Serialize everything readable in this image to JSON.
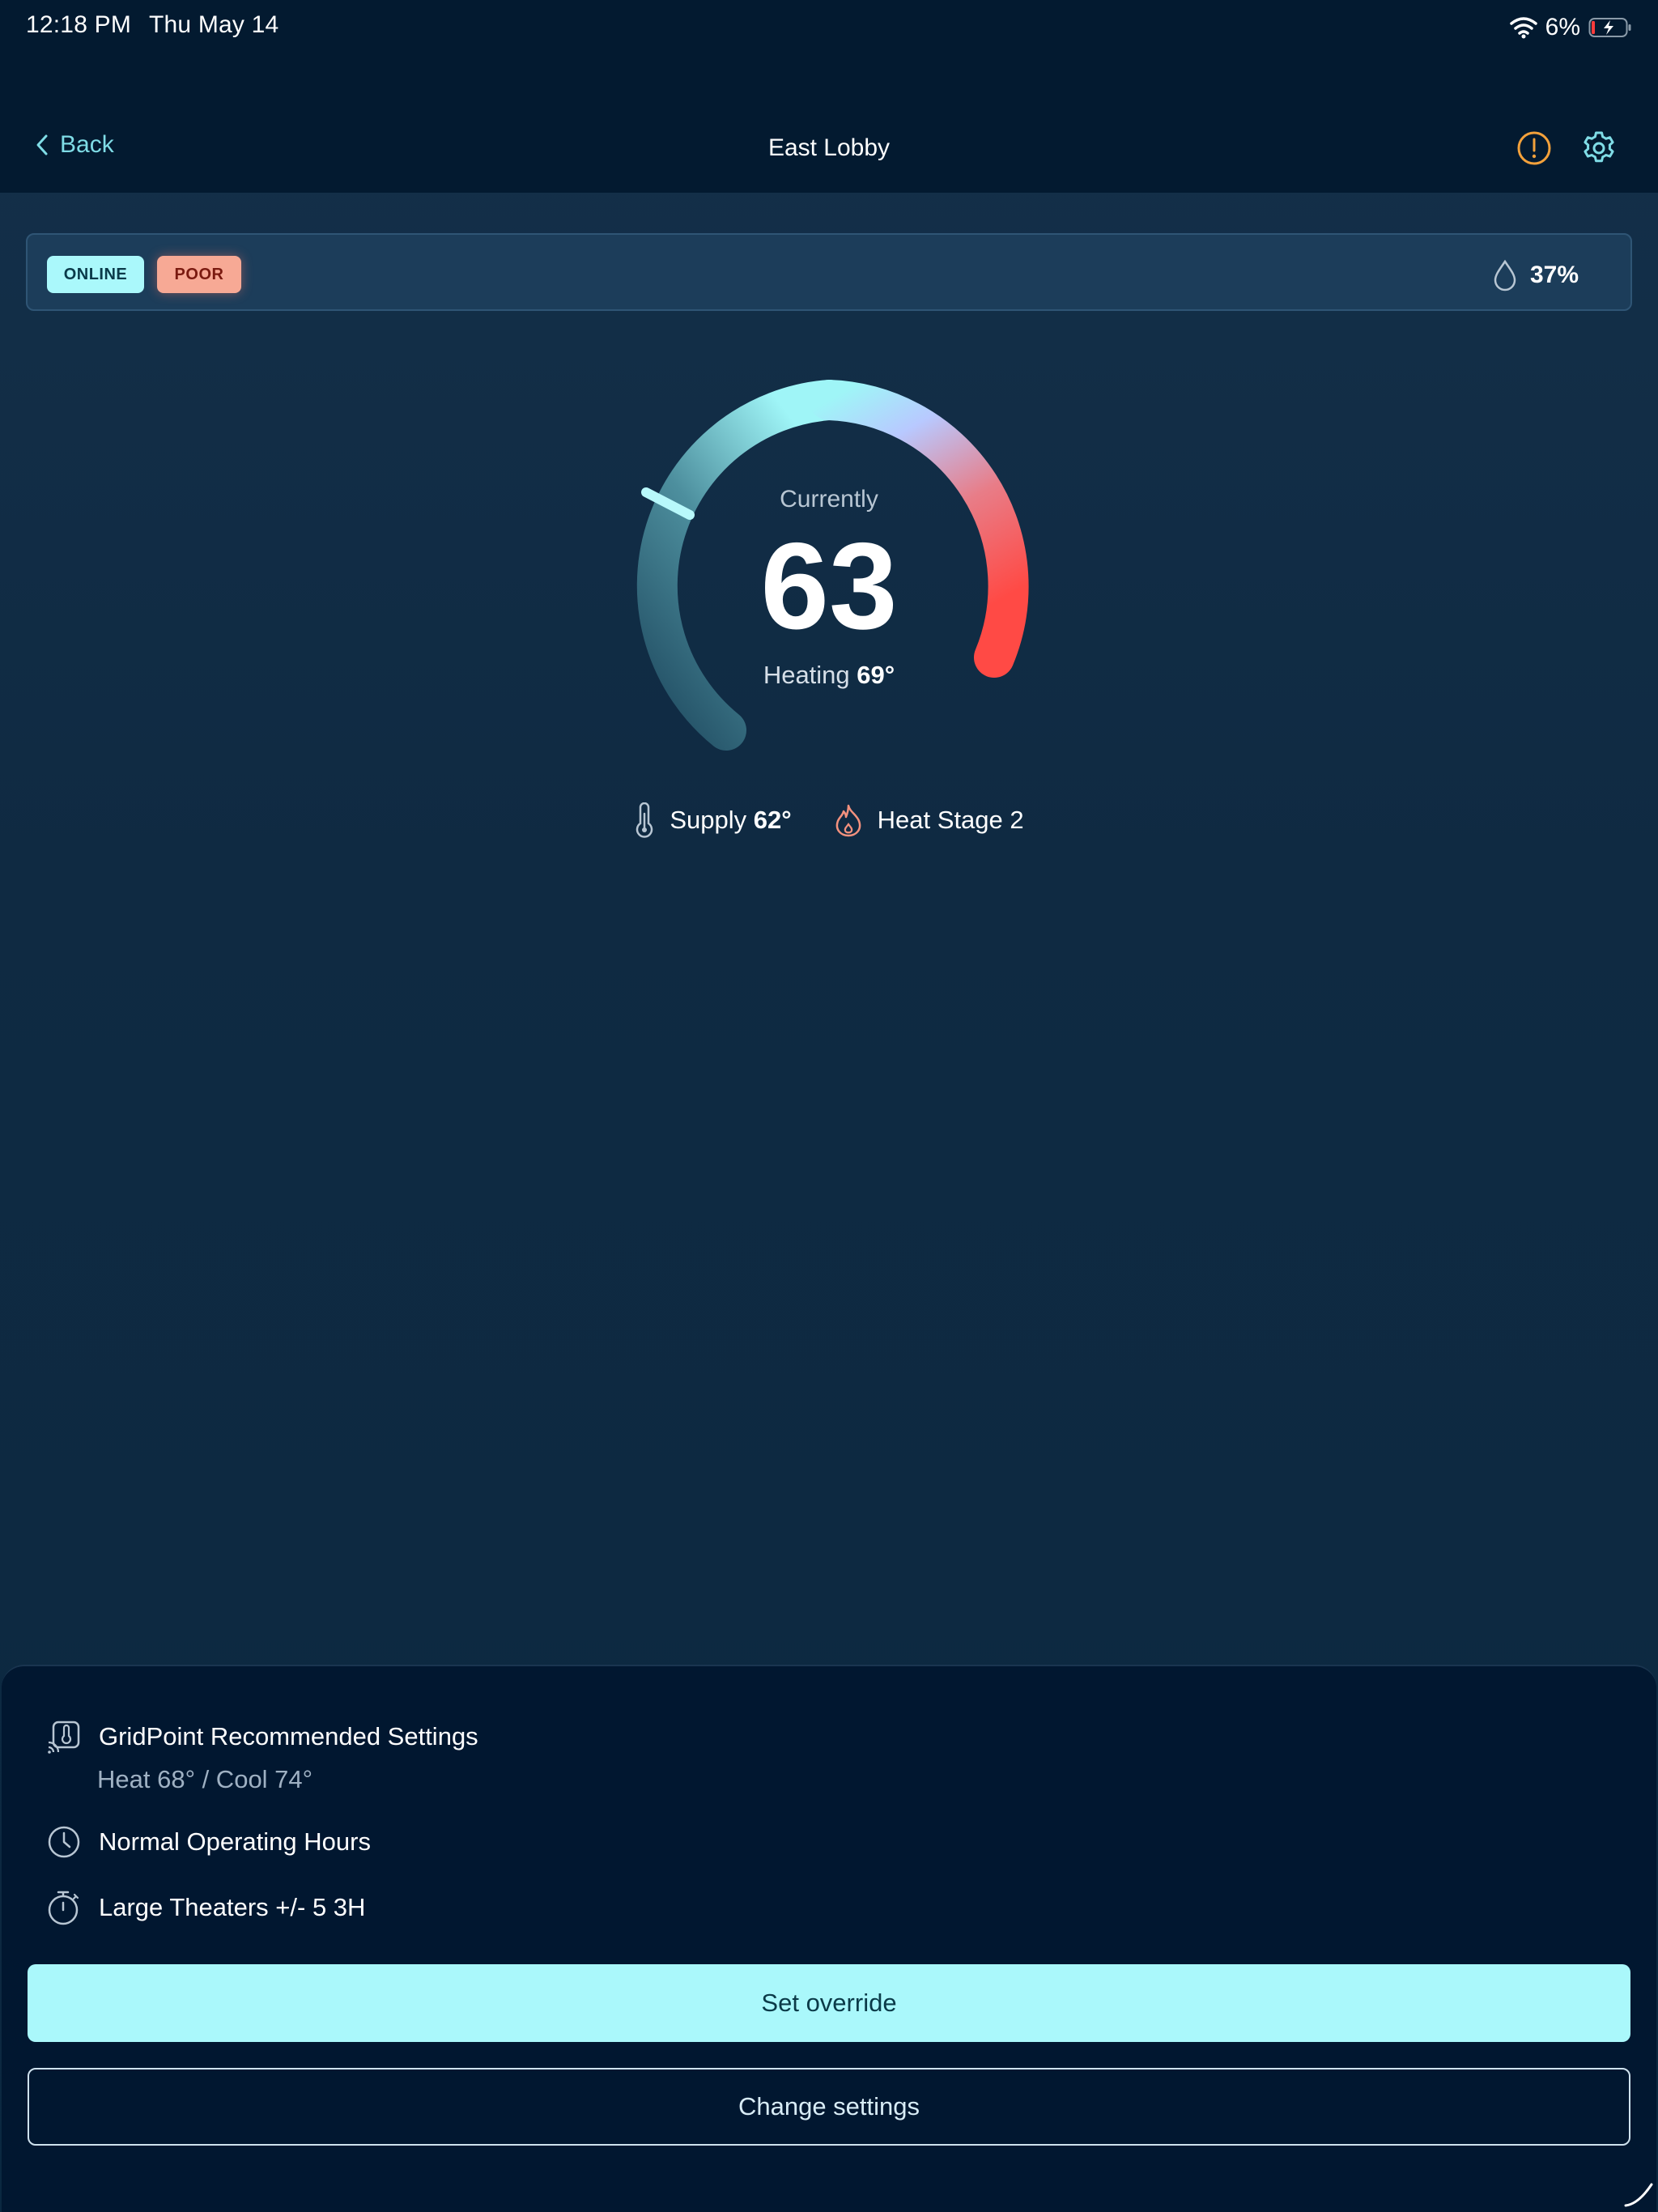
{
  "status_bar": {
    "time": "12:18 PM",
    "date": "Thu May 14",
    "battery": "6%"
  },
  "nav": {
    "back_label": "Back",
    "title": "East Lobby"
  },
  "status_strip": {
    "online_badge": "ONLINE",
    "quality_badge": "POOR",
    "humidity": "37%"
  },
  "gauge": {
    "label": "Currently",
    "current_temp": "63",
    "mode_label": "Heating",
    "setpoint": "69°"
  },
  "info": {
    "supply_label": "Supply",
    "supply_value": "62°",
    "stage": "Heat Stage 2"
  },
  "sheet": {
    "recommended_title": "GridPoint Recommended Settings",
    "recommended_values": "Heat 68° / Cool 74°",
    "hours_label": "Normal Operating Hours",
    "timer_label": "Large Theaters +/- 5 3H",
    "set_override": "Set override",
    "change_settings": "Change settings"
  },
  "colors": {
    "accent_cyan": "#aaf8fb",
    "alert_orange": "#f3a13b",
    "poor_badge": "#f7a995",
    "heat_red": "#ff4f4f"
  }
}
